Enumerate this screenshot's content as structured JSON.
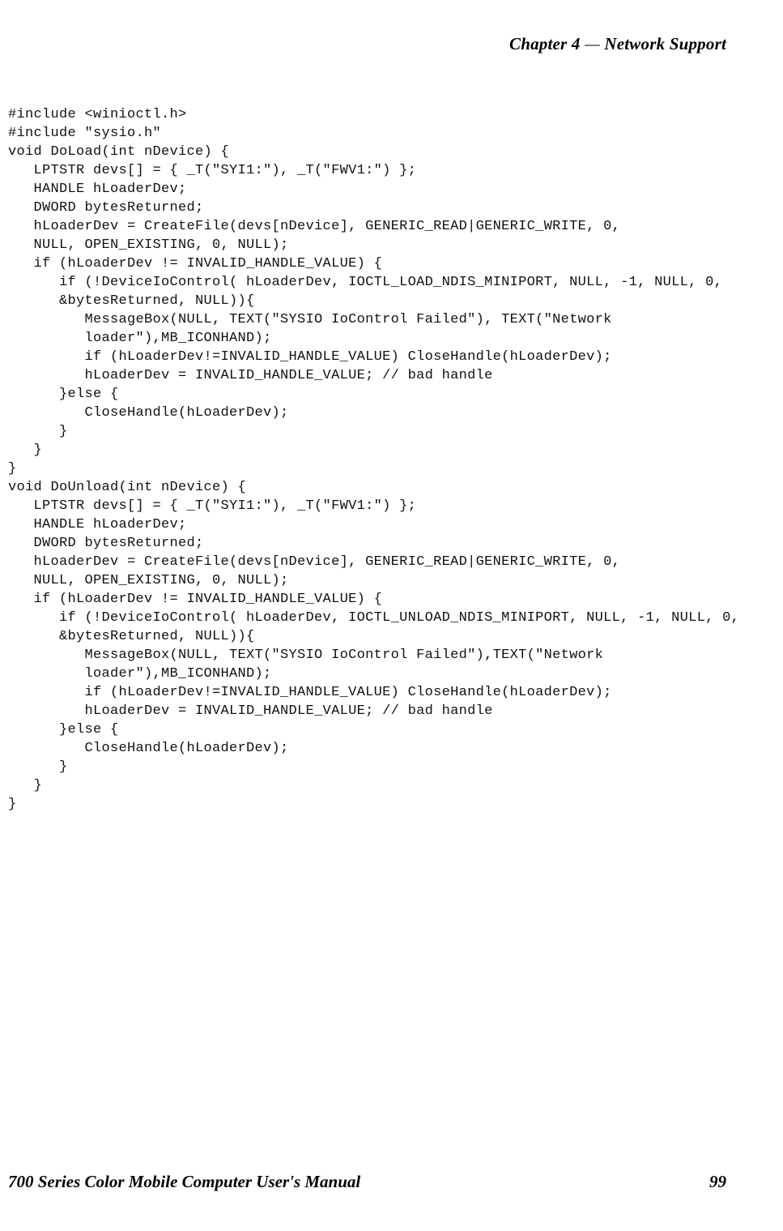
{
  "header": {
    "chapter_label": "Chapter",
    "chapter_number": "4",
    "dash": "—",
    "section_title": "Network Support"
  },
  "code_lines": [
    "#include <winioctl.h>",
    "#include \"sysio.h\"",
    "void DoLoad(int nDevice) {",
    "   LPTSTR devs[] = { _T(\"SYI1:\"), _T(\"FWV1:\") };",
    "   HANDLE hLoaderDev;",
    "   DWORD bytesReturned;",
    "   hLoaderDev = CreateFile(devs[nDevice], GENERIC_READ|GENERIC_WRITE, 0,",
    "   NULL, OPEN_EXISTING, 0, NULL);",
    "   if (hLoaderDev != INVALID_HANDLE_VALUE) {",
    "      if (!DeviceIoControl( hLoaderDev, IOCTL_LOAD_NDIS_MINIPORT, NULL, -1, NULL, 0,",
    "      &bytesReturned, NULL)){",
    "         MessageBox(NULL, TEXT(\"SYSIO IoControl Failed\"), TEXT(\"Network",
    "         loader\"),MB_ICONHAND);",
    "         if (hLoaderDev!=INVALID_HANDLE_VALUE) CloseHandle(hLoaderDev);",
    "         hLoaderDev = INVALID_HANDLE_VALUE; // bad handle",
    "      }else {",
    "         CloseHandle(hLoaderDev);",
    "      }",
    "   }",
    "}",
    "void DoUnload(int nDevice) {",
    "   LPTSTR devs[] = { _T(\"SYI1:\"), _T(\"FWV1:\") };",
    "   HANDLE hLoaderDev;",
    "   DWORD bytesReturned;",
    "   hLoaderDev = CreateFile(devs[nDevice], GENERIC_READ|GENERIC_WRITE, 0,",
    "   NULL, OPEN_EXISTING, 0, NULL);",
    "   if (hLoaderDev != INVALID_HANDLE_VALUE) {",
    "      if (!DeviceIoControl( hLoaderDev, IOCTL_UNLOAD_NDIS_MINIPORT, NULL, -1, NULL, 0,",
    "      &bytesReturned, NULL)){",
    "         MessageBox(NULL, TEXT(\"SYSIO IoControl Failed\"),TEXT(\"Network",
    "         loader\"),MB_ICONHAND);",
    "         if (hLoaderDev!=INVALID_HANDLE_VALUE) CloseHandle(hLoaderDev);",
    "         hLoaderDev = INVALID_HANDLE_VALUE; // bad handle",
    "      }else {",
    "         CloseHandle(hLoaderDev);",
    "      }",
    "   }",
    "}"
  ],
  "footer": {
    "title": "700 Series Color Mobile Computer User's Manual",
    "page_number": "99"
  }
}
